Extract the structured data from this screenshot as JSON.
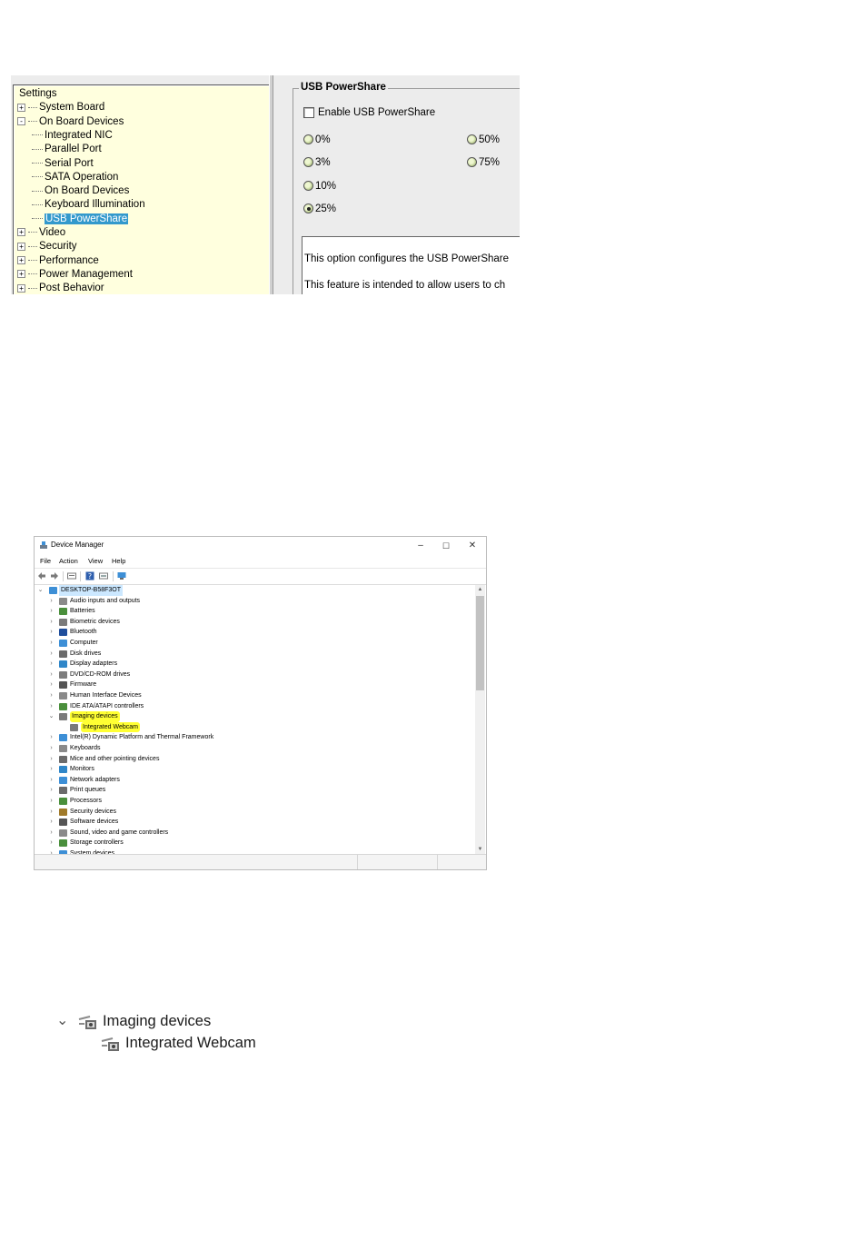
{
  "bios": {
    "tree": [
      {
        "label": "Settings",
        "level": 0,
        "expander": "",
        "selected": false
      },
      {
        "label": "System Board",
        "level": 1,
        "expander": "+",
        "selected": false
      },
      {
        "label": "On Board Devices",
        "level": 1,
        "expander": "-",
        "selected": false
      },
      {
        "label": "Integrated NIC",
        "level": 2,
        "expander": "",
        "selected": false
      },
      {
        "label": "Parallel Port",
        "level": 2,
        "expander": "",
        "selected": false
      },
      {
        "label": "Serial Port",
        "level": 2,
        "expander": "",
        "selected": false
      },
      {
        "label": "SATA Operation",
        "level": 2,
        "expander": "",
        "selected": false
      },
      {
        "label": "On Board Devices",
        "level": 2,
        "expander": "",
        "selected": false
      },
      {
        "label": "Keyboard Illumination",
        "level": 2,
        "expander": "",
        "selected": false
      },
      {
        "label": "USB PowerShare",
        "level": 2,
        "expander": "",
        "selected": true
      },
      {
        "label": "Video",
        "level": 1,
        "expander": "+",
        "selected": false
      },
      {
        "label": "Security",
        "level": 1,
        "expander": "+",
        "selected": false
      },
      {
        "label": "Performance",
        "level": 1,
        "expander": "+",
        "selected": false
      },
      {
        "label": "Power Management",
        "level": 1,
        "expander": "+",
        "selected": false
      },
      {
        "label": "Post Behavior",
        "level": 1,
        "expander": "+",
        "selected": false
      }
    ],
    "group_title": "USB PowerShare",
    "enable_label": "Enable USB PowerShare",
    "enable_checked": false,
    "radios": [
      {
        "label": "0%",
        "checked": false
      },
      {
        "label": "50%",
        "checked": false
      },
      {
        "label": "3%",
        "checked": false
      },
      {
        "label": "75%",
        "checked": false
      },
      {
        "label": "10%",
        "checked": false
      },
      {
        "label": "25%",
        "checked": true
      }
    ],
    "description": [
      "This option configures the USB PowerShare",
      "This feature is intended to allow users to ch"
    ]
  },
  "device_manager": {
    "title": "Device Manager",
    "window_buttons": {
      "minimize": "–",
      "maximize": "☐",
      "close": "✕"
    },
    "menu": [
      "File",
      "Action",
      "View",
      "Help"
    ],
    "root": "DESKTOP-B58F3OT",
    "items": [
      {
        "label": "Audio inputs and outputs",
        "icon": "speaker-icon",
        "color": "#8a8a8a"
      },
      {
        "label": "Batteries",
        "icon": "battery-icon",
        "color": "#4a8f3c"
      },
      {
        "label": "Biometric devices",
        "icon": "fingerprint-icon",
        "color": "#7a7a7a"
      },
      {
        "label": "Bluetooth",
        "icon": "bluetooth-icon",
        "color": "#1f4e9c"
      },
      {
        "label": "Computer",
        "icon": "computer-icon",
        "color": "#3d8fd6"
      },
      {
        "label": "Disk drives",
        "icon": "disk-icon",
        "color": "#6b6b6b"
      },
      {
        "label": "Display adapters",
        "icon": "display-adapter-icon",
        "color": "#2f86c8"
      },
      {
        "label": "DVD/CD-ROM drives",
        "icon": "dvd-icon",
        "color": "#7d7d7d"
      },
      {
        "label": "Firmware",
        "icon": "firmware-icon",
        "color": "#555555"
      },
      {
        "label": "Human Interface Devices",
        "icon": "hid-icon",
        "color": "#8a8a8a"
      },
      {
        "label": "IDE ATA/ATAPI controllers",
        "icon": "ide-icon",
        "color": "#4a8f3c"
      },
      {
        "label": "Imaging devices",
        "icon": "camera-icon",
        "color": "#7a7a7a",
        "expanded": true,
        "highlight": true
      },
      {
        "label": "Integrated Webcam",
        "icon": "webcam-icon",
        "color": "#7a7a7a",
        "child": true,
        "highlight": true
      },
      {
        "label": "Intel(R) Dynamic Platform and Thermal Framework",
        "icon": "chip-icon",
        "color": "#3d8fd6"
      },
      {
        "label": "Keyboards",
        "icon": "keyboard-icon",
        "color": "#8a8a8a"
      },
      {
        "label": "Mice and other pointing devices",
        "icon": "mouse-icon",
        "color": "#6b6b6b"
      },
      {
        "label": "Monitors",
        "icon": "monitor-icon",
        "color": "#2f86c8"
      },
      {
        "label": "Network adapters",
        "icon": "network-icon",
        "color": "#3d8fd6"
      },
      {
        "label": "Print queues",
        "icon": "printer-icon",
        "color": "#6b6b6b"
      },
      {
        "label": "Processors",
        "icon": "processor-icon",
        "color": "#4a8f3c"
      },
      {
        "label": "Security devices",
        "icon": "security-icon",
        "color": "#a07a2a"
      },
      {
        "label": "Software devices",
        "icon": "software-icon",
        "color": "#555555"
      },
      {
        "label": "Sound, video and game controllers",
        "icon": "sound-icon",
        "color": "#8a8a8a"
      },
      {
        "label": "Storage controllers",
        "icon": "storage-icon",
        "color": "#4a8f3c"
      },
      {
        "label": "System devices",
        "icon": "system-icon",
        "color": "#3d8fd6"
      }
    ],
    "highlight_color": "#ffff33"
  },
  "zoom": {
    "parent": "Imaging devices",
    "child": "Integrated Webcam"
  }
}
